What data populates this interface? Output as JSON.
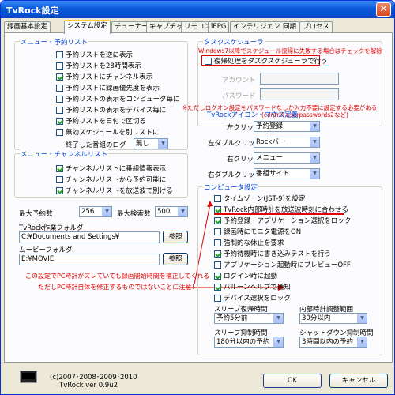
{
  "window": {
    "title": "TvRock設定",
    "close_glyph": "✕"
  },
  "tabs": [
    "録画基本設定",
    "システム設定",
    "チューナー",
    "キャプチャ",
    "リモコン",
    "iEPG",
    "インテリジェント",
    "同期",
    "プロセス"
  ],
  "active_tab": 1,
  "menu_yoyaku": {
    "title": "メニュー・予約リスト",
    "items": [
      {
        "label": "予約リストを逆に表示",
        "checked": false
      },
      {
        "label": "予約リストを28時間表示",
        "checked": false
      },
      {
        "label": "予約リストにチャンネル表示",
        "checked": true
      },
      {
        "label": "予約リストに録画優先度を表示",
        "checked": false
      },
      {
        "label": "予約リストの表示をコンピュータ毎に",
        "checked": false
      },
      {
        "label": "予約リストの表示をデバイス毎に",
        "checked": false
      },
      {
        "label": "予約リストを日付で区切る",
        "checked": true
      },
      {
        "label": "無効スケジュールを別リストに",
        "checked": false
      }
    ],
    "end_log_label": "終了した番組のログ",
    "end_log_value": "無し"
  },
  "menu_channel": {
    "title": "メニュー・チャンネルリスト",
    "items": [
      {
        "label": "チャンネルリストに番組情報表示",
        "checked": true
      },
      {
        "label": "チャンネルリストから予約可能に",
        "checked": false
      },
      {
        "label": "チャンネルリストを放送波で別ける",
        "checked": true
      }
    ]
  },
  "max_reserve": {
    "label": "最大予約数",
    "value": "256"
  },
  "max_search": {
    "label": "最大検索数",
    "value": "500"
  },
  "work_folder": {
    "label": "TvRock作業フォルダ",
    "value": "C:¥Documents and Settings¥",
    "browse": "参照"
  },
  "movie_folder": {
    "label": "ムービーフォルダ",
    "value": "E:¥MOVIE",
    "browse": "参照"
  },
  "left_note": {
    "line1": "この設定でPC時計がズレていても録画開始時間を補正してくれる",
    "line2": "ただしPC時計自体を修正するものではないことに注意！"
  },
  "task_scheduler": {
    "title": "タスクスケジューラ",
    "note": "Windows7以降でスケジュール復帰に失敗する場合はチェックを解除",
    "resume_label": "復帰処理をタスクスケジューラで行う",
    "resume_checked": false,
    "account_label": "アカウント",
    "password_label": "パスワード",
    "note2": "※ただしログオン設定をパスワードなしか入力不要に設定する必要がある",
    "note3": "(control userpasswords2など)"
  },
  "tvrock_icon": {
    "title": "TvRockアイコン・マウス定義",
    "rows": [
      {
        "label": "左クリック",
        "value": "予約登録"
      },
      {
        "label": "左ダブルクリック",
        "value": "Rockバー"
      },
      {
        "label": "右クリック",
        "value": "メニュー"
      },
      {
        "label": "右ダブルクリック",
        "value": "番組サイト"
      }
    ]
  },
  "computer": {
    "title": "コンピュータ設定",
    "items": [
      {
        "label": "タイムゾーン(JST-9)を設定",
        "checked": false
      },
      {
        "label": "TvRock内部時計を放送波時刻に合わせる",
        "checked": true
      },
      {
        "label": "予約登録・アプリケーション選択をロック",
        "checked": true
      },
      {
        "label": "録画時にモニタ電源をON",
        "checked": false
      },
      {
        "label": "強制的な休止を要求",
        "checked": false
      },
      {
        "label": "予約待機時に書き込みテストを行う",
        "checked": true
      },
      {
        "label": "アプリケーション起動時にプレビューOFF",
        "checked": false
      },
      {
        "label": "ログイン時に起動",
        "checked": true
      },
      {
        "label": "バルーンヘルプで通知",
        "checked": true
      },
      {
        "label": "デバイス選択をロック",
        "checked": false
      }
    ],
    "sleep_return": {
      "label": "スリープ復帰時間",
      "value": "予約5分前"
    },
    "clock_adjust": {
      "label": "内部時計調整範囲",
      "value": "30分以内"
    },
    "sleep_suppress": {
      "label": "スリープ抑制時間",
      "value": "180分以内の予約"
    },
    "shutdown_suppress": {
      "label": "シャットダウン抑制時間",
      "value": "3時間以内の予約"
    }
  },
  "footer": {
    "copyright": "(c)2007･2008･2009･2010",
    "version": "TvRock ver 0.9u2",
    "ok": "OK",
    "cancel": "キャンセル"
  }
}
